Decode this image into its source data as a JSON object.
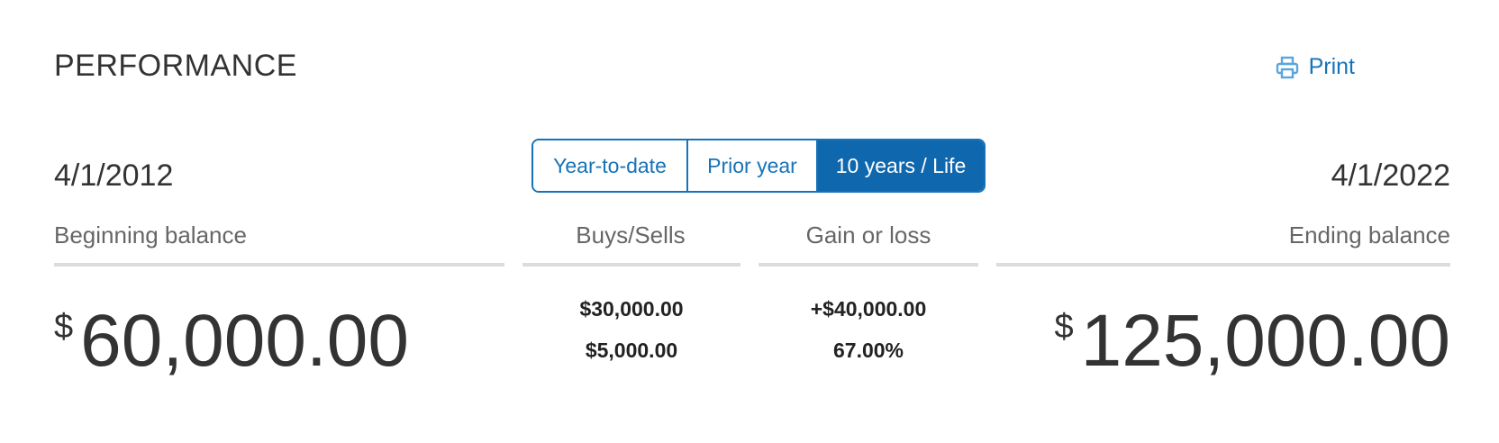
{
  "header": {
    "title": "PERFORMANCE",
    "print_label": "Print",
    "print_icon": "printer-icon"
  },
  "period_toggle": {
    "options": [
      "Year-to-date",
      "Prior year",
      "10 years / Life"
    ],
    "selected": "10 years / Life"
  },
  "beginning": {
    "date": "4/1/2012",
    "label": "Beginning balance",
    "currency": "$",
    "amount": "60,000.00"
  },
  "buys_sells": {
    "label": "Buys/Sells",
    "buys": "$30,000.00",
    "sells": "$5,000.00"
  },
  "gain_loss": {
    "label": "Gain or loss",
    "amount": "+$40,000.00",
    "percent": "67.00%"
  },
  "ending": {
    "date": "4/1/2022",
    "label": "Ending balance",
    "currency": "$",
    "amount": "125,000.00"
  },
  "colors": {
    "accent": "#1673b8",
    "active_segment": "#0f67ad",
    "rule": "#dcdcdc"
  }
}
